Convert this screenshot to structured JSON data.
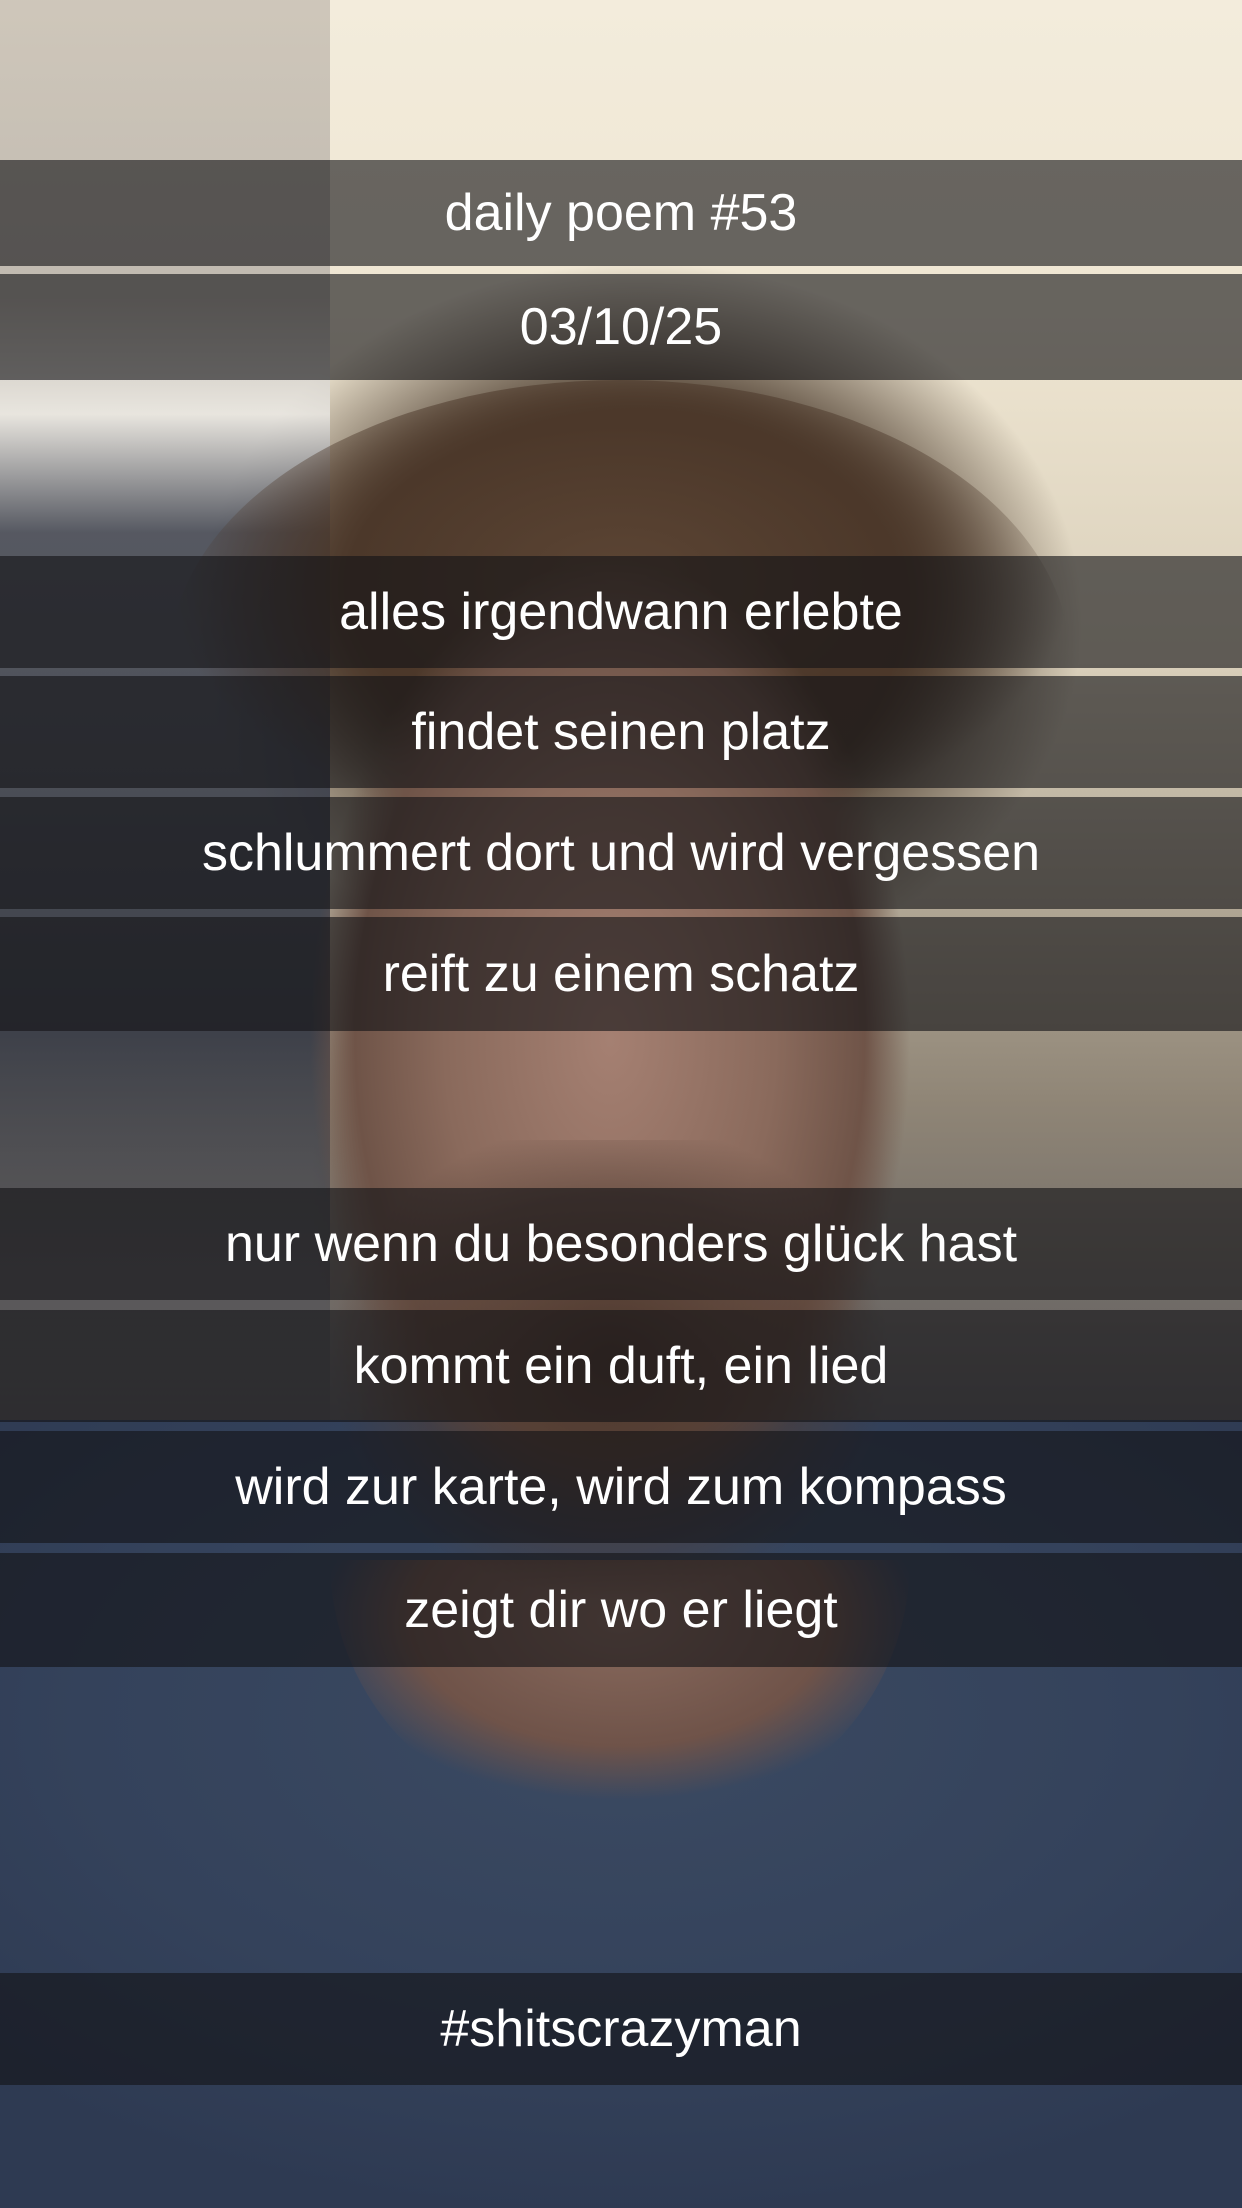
{
  "header": {
    "title": "daily poem #53",
    "date": "03/10/25"
  },
  "poem": {
    "stanza1": [
      "alles irgendwann erlebte",
      "findet seinen platz",
      "schlummert dort und wird vergessen",
      "reift zu einem schatz"
    ],
    "stanza2": [
      "nur wenn du besonders glück hast",
      "kommt ein duft, ein lied",
      "wird zur karte, wird zum kompass",
      "zeigt dir wo er liegt"
    ]
  },
  "footer": {
    "hashtag": "#shitscrazyman"
  }
}
